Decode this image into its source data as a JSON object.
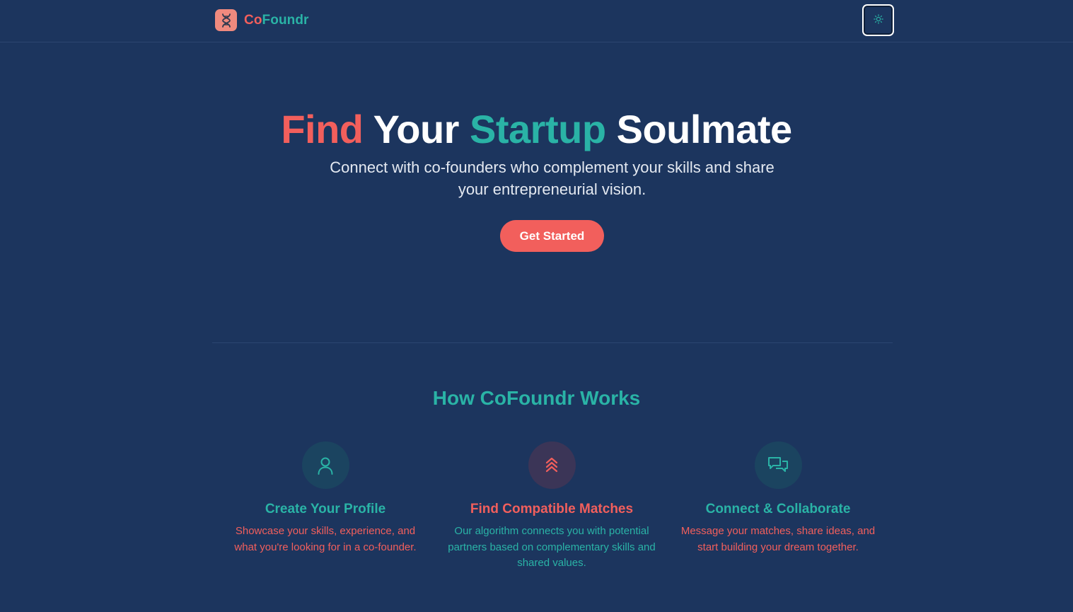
{
  "brand": {
    "name_part1": "Co",
    "name_part2": "Foundr",
    "logo_icon": "dna-icon"
  },
  "header": {
    "theme_toggle_icon": "sun-icon"
  },
  "hero": {
    "title_words": [
      "Find",
      "Your",
      "Startup",
      "Soulmate"
    ],
    "subtitle": "Connect with co-founders who complement your skills and share your entrepreneurial vision.",
    "cta_label": "Get Started"
  },
  "how_it_works": {
    "title": "How CoFoundr Works",
    "features": [
      {
        "icon": "user-icon",
        "title": "Create Your Profile",
        "description": "Showcase your skills, experience, and what you're looking for in a co-founder."
      },
      {
        "icon": "chevrons-up-icon",
        "title": "Find Compatible Matches",
        "description": "Our algorithm connects you with potential partners based on complementary skills and shared values."
      },
      {
        "icon": "chat-bubbles-icon",
        "title": "Connect & Collaborate",
        "description": "Message your matches, share ideas, and start building your dream together."
      }
    ]
  },
  "colors": {
    "background": "#1c355e",
    "coral": "#f25f5c",
    "teal": "#2ab3a6",
    "logo_bg": "#f08a7e"
  }
}
